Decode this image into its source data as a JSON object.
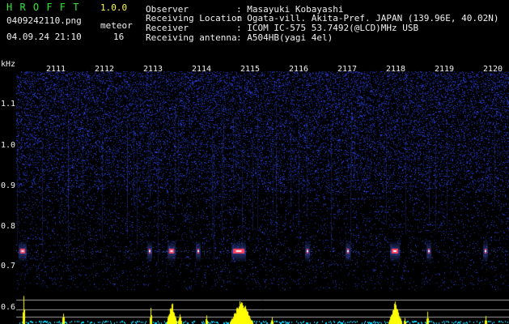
{
  "app": {
    "name": "H R O F F T",
    "version": "1.0.0"
  },
  "file": {
    "name": "0409242110.png",
    "datetime": "04.09.24 21:10"
  },
  "meteor": {
    "label": "meteor",
    "count": "16"
  },
  "info": {
    "observer_label": "Observer",
    "observer_value": ": Masayuki Kobayashi",
    "location_label": "Receiving Location",
    "location_value": ": Ogata-vill. Akita-Pref. JAPAN (139.96E, 40.02N)",
    "receiver_label": "Receiver",
    "receiver_value": ": ICOM IC-575 53.7492(@LCD)MHz USB",
    "antenna_label": "Receiving antenna",
    "antenna_value": ": A504HB(yagi 4el)"
  },
  "axis": {
    "unit": "kHz",
    "time_ticks": [
      "2111",
      "2112",
      "2113",
      "2114",
      "2115",
      "2116",
      "2117",
      "2118",
      "2119",
      "2120"
    ],
    "freq_ticks": [
      "1.1",
      "1.0",
      "0.9",
      "0.8",
      "0.7",
      "0.6"
    ]
  },
  "colors": {
    "background": "#000000",
    "noise": "#3040c0",
    "echo": "#ff4060",
    "echo_core": "#ffffff",
    "histogram": "#ffff00",
    "cyan": "#00e0ff",
    "header_green": "#2ee82e",
    "header_yellow": "#ffff3a"
  }
}
